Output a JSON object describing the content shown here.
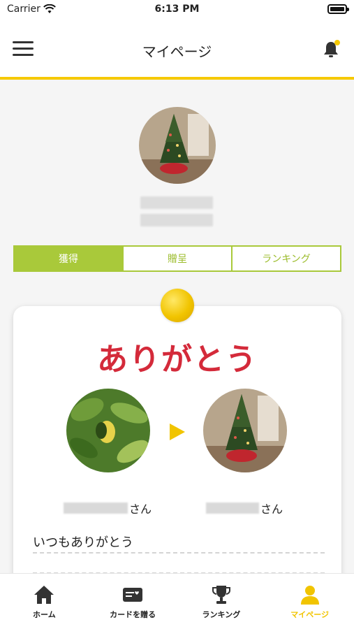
{
  "status_bar": {
    "carrier": "Carrier",
    "time": "6:13 PM"
  },
  "navbar": {
    "title": "マイページ"
  },
  "tabs": [
    {
      "label": "獲得",
      "active": true
    },
    {
      "label": "贈呈",
      "active": false
    },
    {
      "label": "ランキング",
      "active": false
    }
  ],
  "card": {
    "title": "ありがとう",
    "sender_suffix": "さん",
    "receiver_suffix": "さん",
    "message": "いつもありがとう"
  },
  "tabbar": [
    {
      "label": "ホーム",
      "icon": "home-icon",
      "active": false
    },
    {
      "label": "カードを贈る",
      "icon": "card-icon",
      "active": false
    },
    {
      "label": "ランキング",
      "icon": "trophy-icon",
      "active": false
    },
    {
      "label": "マイページ",
      "icon": "person-icon",
      "active": true
    }
  ],
  "colors": {
    "accent_yellow": "#f6c900",
    "tab_green": "#a9c93a",
    "title_red": "#d42a3a"
  }
}
